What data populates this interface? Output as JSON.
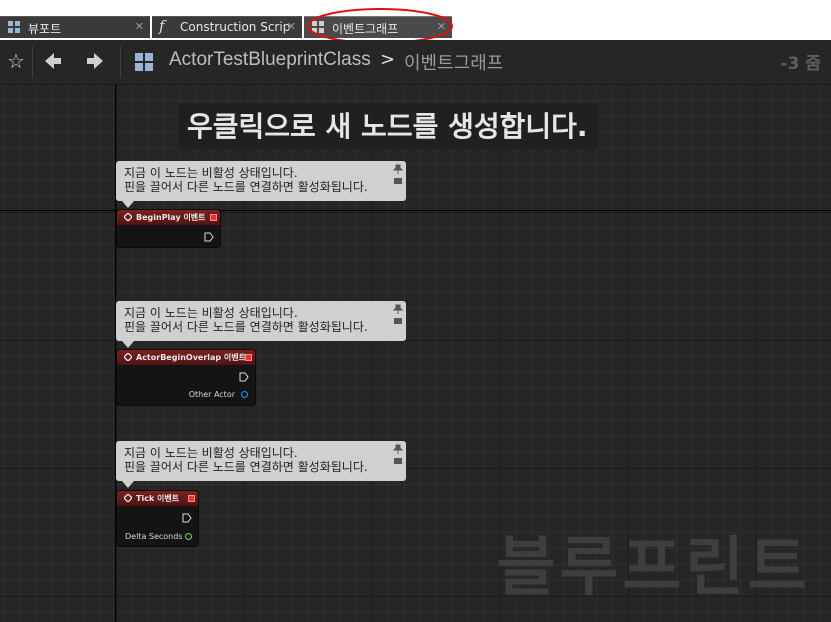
{
  "tabs": [
    {
      "label": "뷰포트",
      "icon": "viewport-icon",
      "active": false
    },
    {
      "label": "Construction Scrip",
      "icon": "function-icon",
      "active": false
    },
    {
      "label": "이벤트그래프",
      "icon": "event-graph-icon",
      "active": true
    }
  ],
  "toolbar": {
    "breadcrumb_class": "ActorTestBlueprintClass",
    "breadcrumb_separator": ">",
    "breadcrumb_graph": "이벤트그래프",
    "zoom": "-3 줌"
  },
  "graph": {
    "hint": "우클릭으로 새 노드를 생성합니다.",
    "watermark": "블루프린트"
  },
  "comments": [
    {
      "line1": "지금 이 노드는 비활성 상태입니다.",
      "line2": "핀을 끌어서 다른 노드를 연결하면 활성화됩니다."
    },
    {
      "line1": "지금 이 노드는 비활성 상태입니다.",
      "line2": "핀을 끌어서 다른 노드를 연결하면 활성화됩니다."
    },
    {
      "line1": "지금 이 노드는 비활성 상태입니다.",
      "line2": "핀을 끌어서 다른 노드를 연결하면 활성화됩니다."
    }
  ],
  "nodes": [
    {
      "title": "BeginPlay 이벤트",
      "pin_label": ""
    },
    {
      "title": "ActorBeginOverlap 이벤트",
      "pin_label": "Other Actor"
    },
    {
      "title": "Tick 이벤트",
      "pin_label": "Delta Seconds"
    }
  ],
  "colors": {
    "node_header": "#7d2020",
    "object_pin": "#00a8ff",
    "float_pin": "#8ad74a",
    "annotation_circle": "#e01010"
  }
}
